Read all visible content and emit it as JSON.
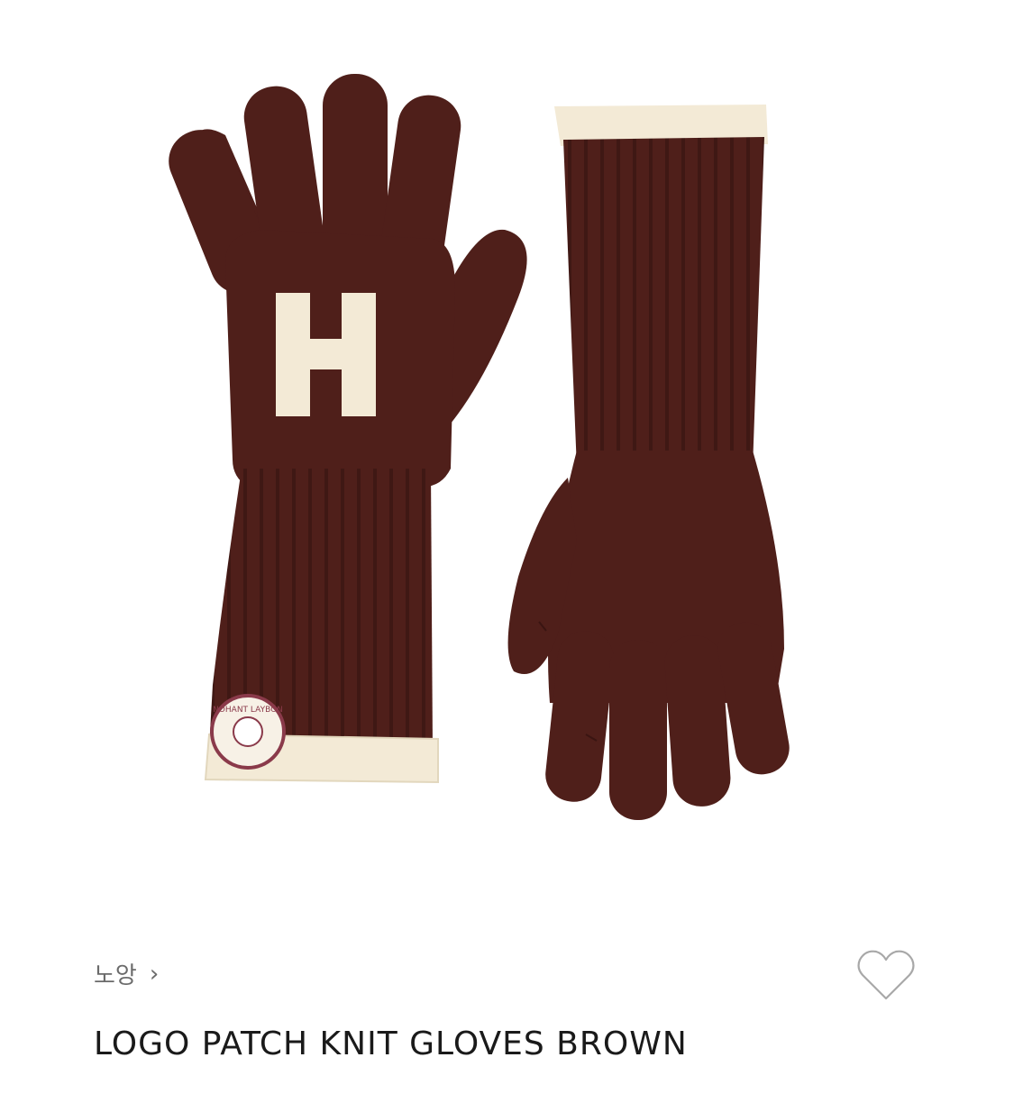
{
  "product": {
    "brand": "노앙",
    "title": "LOGO PATCH KNIT GLOVES BROWN",
    "patch_text": "NOHANT LAYBON"
  },
  "icons": {
    "brand_chevron": "chevron-right-icon",
    "wishlist": "heart-outline-icon"
  },
  "colors": {
    "glove_brown": "#4f1f1a",
    "cuff_cream": "#f3ead6",
    "text": "#1a1a1a",
    "muted_text": "#6b6b6b"
  }
}
